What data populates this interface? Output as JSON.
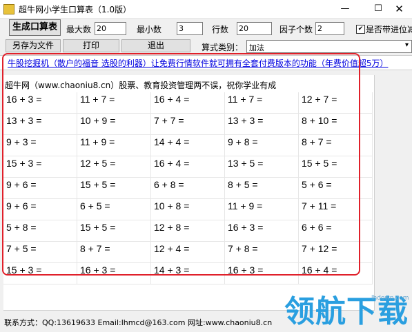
{
  "window": {
    "title": "超牛网小学生口算表（1.0版）",
    "min": "—",
    "max": "☐",
    "close": "✕"
  },
  "toolbar": {
    "generate": "生成口算表",
    "save_as": "另存为文件",
    "print": "打印",
    "exit": "退出",
    "max_label": "最大数",
    "max_value": "20",
    "min_label": "最小数",
    "min_value": "3",
    "rows_label": "行数",
    "rows_value": "20",
    "factors_label": "因子个数",
    "factors_value": "2",
    "carry_label": "是否带进位减",
    "carry_checked": "✔",
    "type_label": "算式类别：",
    "type_value": "加法"
  },
  "promo": {
    "link_text": "牛股挖掘机（散户的福音 选股的利器）让免费行情软件就可拥有全套付费版本的功能（年费价值超5万）"
  },
  "sheet": {
    "header": "超牛网（www.chaoniu8.cn）股票、教育投资管理两不误，祝你学业有成",
    "rows": [
      [
        "16 + 3 =",
        "11 + 7 =",
        "16 + 4 =",
        "11 + 7 =",
        "12 + 7 ="
      ],
      [
        "13 + 3 =",
        "10 + 9 =",
        "7 + 7 =",
        "13 + 3 =",
        "8 + 10 ="
      ],
      [
        "9 + 3 =",
        "11 + 9 =",
        "14 + 4 =",
        "9 + 8 =",
        "8 + 7 ="
      ],
      [
        "15 + 3 =",
        "12 + 5 =",
        "16 + 4 =",
        "13 + 5 =",
        "15 + 5 ="
      ],
      [
        "9 + 6 =",
        "15 + 5 =",
        "6 + 8 =",
        "8 + 5 =",
        "5 + 6 ="
      ],
      [
        "9 + 6 =",
        "6 + 5 =",
        "10 + 8 =",
        "11 + 9 =",
        "7 + 11 ="
      ],
      [
        "5 + 8 =",
        "15 + 5 =",
        "12 + 8 =",
        "16 + 3 =",
        "6 + 6 ="
      ],
      [
        "7 + 5 =",
        "8 + 7 =",
        "12 + 4 =",
        "7 + 8 =",
        "7 + 12 ="
      ],
      [
        "15 + 3 =",
        "16 + 3 =",
        "14 + 3 =",
        "16 + 3 =",
        "16 + 4 ="
      ]
    ]
  },
  "footer": {
    "contact": "联系方式：QQ:13619633  Email:lhmcd@163.com 网址:www.chaoniu8.cn"
  },
  "watermark": {
    "brand": "领航下载",
    "url": "lhdown.com"
  },
  "colors": {
    "highlight": "#e0202a",
    "link": "#0000e0",
    "watermark": "#2a9fe0"
  }
}
